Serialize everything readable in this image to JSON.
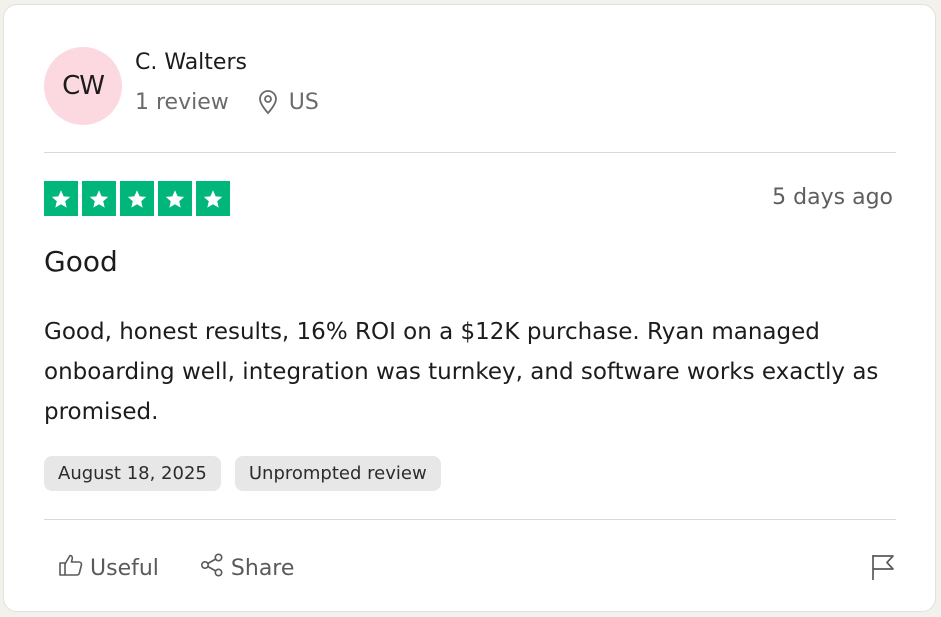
{
  "reviewer": {
    "initials": "CW",
    "name": "C. Walters",
    "review_count": "1 review",
    "location": "US",
    "avatar_color": "#fcd9e0"
  },
  "rating": {
    "stars": 5,
    "max_stars": 5,
    "star_color": "#00b67a",
    "posted_ago": "5 days ago"
  },
  "review": {
    "title": "Good",
    "body": "Good, honest results, 16% ROI on a $12K purchase. Ryan managed onboarding well, integration was turnkey, and software works exactly as promised."
  },
  "tags": {
    "date": "August 18, 2025",
    "type": "Unprompted review"
  },
  "actions": {
    "useful_label": "Useful",
    "share_label": "Share",
    "icons": [
      "thumbs-up-icon",
      "share-icon",
      "flag-icon"
    ]
  }
}
